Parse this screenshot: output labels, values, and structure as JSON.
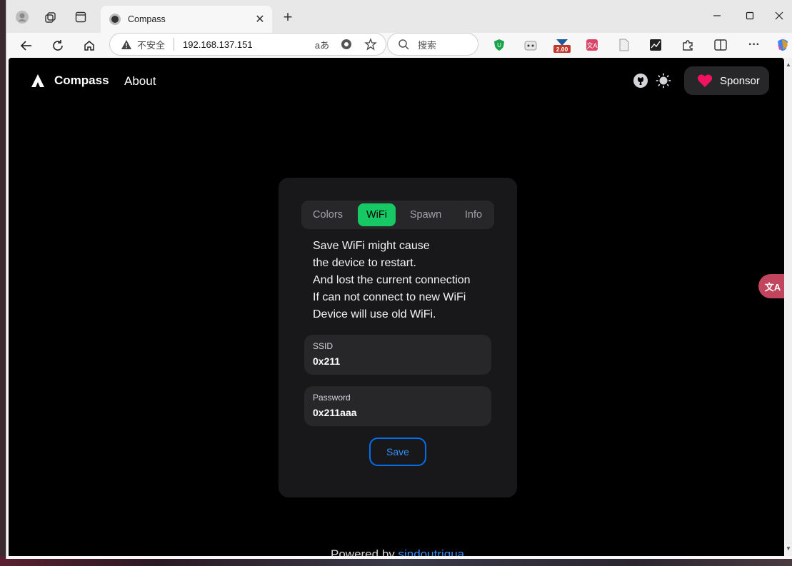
{
  "browser": {
    "tab_title": "Compass",
    "tab_close": "✕",
    "new_tab": "+",
    "insecure_label": "不安全",
    "url": "192.168.137.151",
    "read_aloud": "aあ",
    "search_placeholder": "搜索",
    "ext_badge": "2.00",
    "more": "···"
  },
  "nav": {
    "brand": "Compass",
    "about": "About",
    "sponsor": "Sponsor"
  },
  "tabs": [
    {
      "label": "Colors",
      "active": false
    },
    {
      "label": "WiFi",
      "active": true
    },
    {
      "label": "Spawn",
      "active": false
    },
    {
      "label": "Info",
      "active": false
    }
  ],
  "warning_lines": [
    "Save WiFi might cause",
    "the device to restart.",
    "And lost the current connection",
    "If can not connect to new WiFi",
    "Device will use old WiFi."
  ],
  "form": {
    "ssid_label": "SSID",
    "ssid_value": "0x211",
    "password_label": "Password",
    "password_value": "0x211aaa",
    "save": "Save"
  },
  "footer": {
    "prefix": "Powered by ",
    "link": "sindoutriqua"
  },
  "colors": {
    "accent_green": "#17c964",
    "primary_blue": "#006fee",
    "page_bg": "#000000",
    "card_bg": "#18181b"
  }
}
